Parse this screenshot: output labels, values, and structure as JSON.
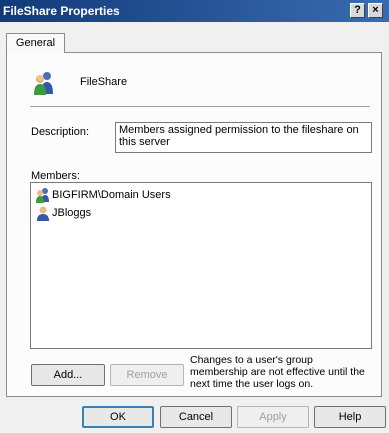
{
  "window": {
    "title": "FileShare Properties",
    "help_glyph": "?",
    "close_glyph": "×"
  },
  "tabs": [
    {
      "label": "General"
    }
  ],
  "object": {
    "name": "FileShare",
    "icon": "group-icon"
  },
  "description": {
    "label": "Description:",
    "value": "Members assigned permission to the fileshare on this server"
  },
  "members": {
    "label": "Members:",
    "items": [
      {
        "name": "BIGFIRM\\Domain Users",
        "icon": "group-icon"
      },
      {
        "name": "JBloggs",
        "icon": "user-icon"
      }
    ]
  },
  "actions": {
    "add_label": "Add...",
    "remove_label": "Remove",
    "note": "Changes to a user's group membership are not effective until the next time the user logs on."
  },
  "footer": {
    "ok_label": "OK",
    "cancel_label": "Cancel",
    "apply_label": "Apply",
    "help_label": "Help"
  }
}
